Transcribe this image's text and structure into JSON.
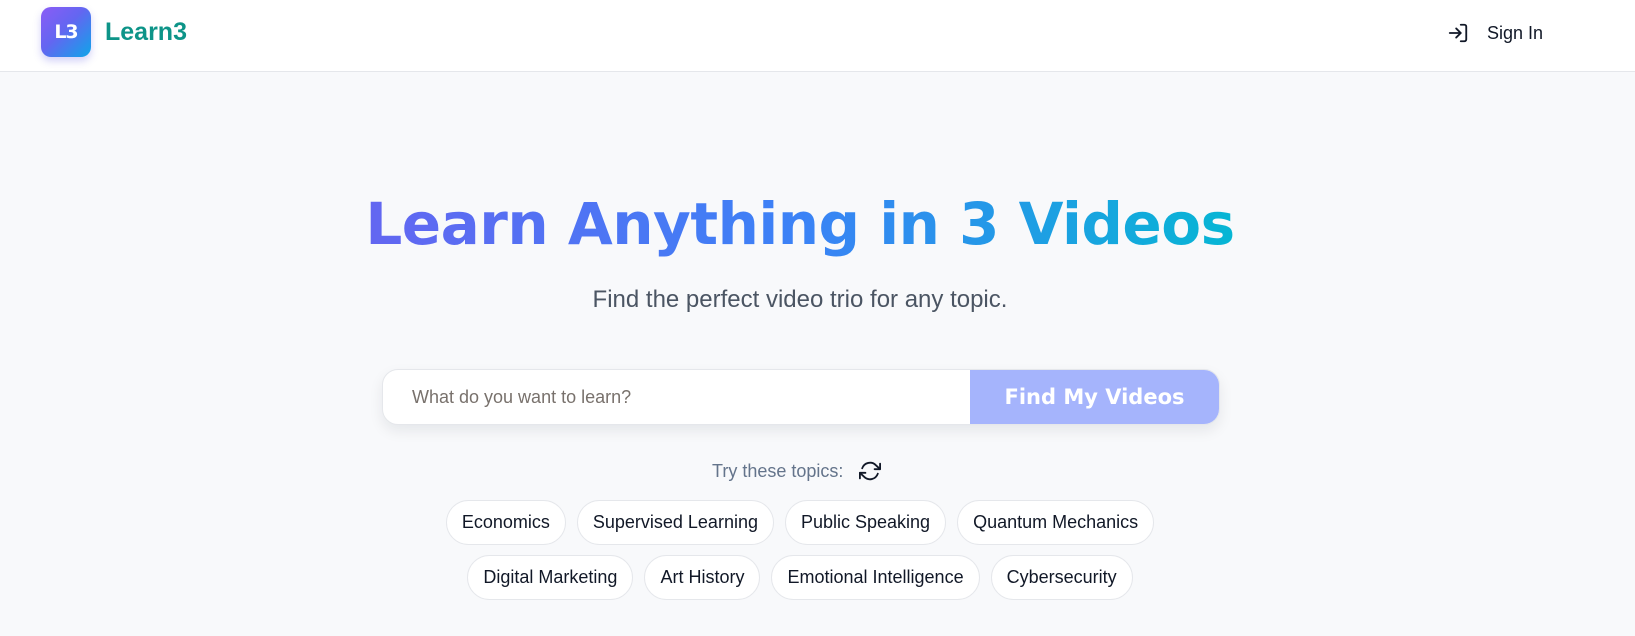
{
  "header": {
    "logo_text": "L3",
    "brand": "Learn3",
    "signin_label": "Sign In",
    "signin_icon": "sign-in-icon"
  },
  "hero": {
    "title": "Learn Anything in 3 Videos",
    "subtitle": "Find the perfect video trio for any topic."
  },
  "search": {
    "placeholder": "What do you want to learn?",
    "value": "",
    "button_label": "Find My Videos"
  },
  "topics": {
    "label": "Try these topics:",
    "refresh_icon": "refresh-icon",
    "row1": [
      "Economics",
      "Supervised Learning",
      "Public Speaking",
      "Quantum Mechanics"
    ],
    "row2": [
      "Digital Marketing",
      "Art History",
      "Emotional Intelligence",
      "Cybersecurity"
    ]
  },
  "colors": {
    "brand": "#0d9488",
    "accent": "#6366f1",
    "gradient_end": "#06b6d4",
    "button_bg": "#a5b4fc",
    "page_bg": "#f8f9fb"
  }
}
